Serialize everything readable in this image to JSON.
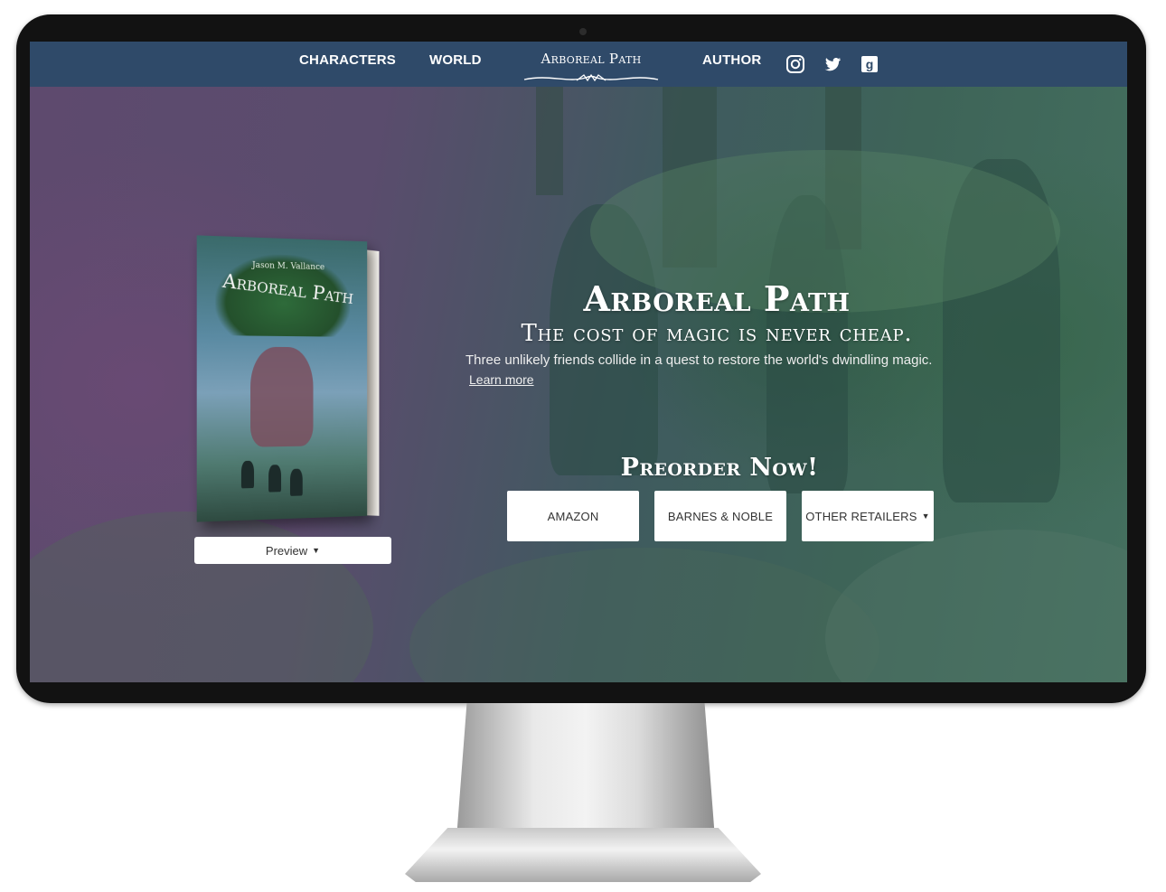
{
  "nav": {
    "links": [
      "CHARACTERS",
      "WORLD",
      "AUTHOR"
    ],
    "brand": "Arboreal Path",
    "social": [
      "instagram-icon",
      "twitter-icon",
      "goodreads-icon"
    ]
  },
  "book": {
    "author": "Jason M. Vallance",
    "title": "Arboreal Path"
  },
  "preview": {
    "label": "Preview"
  },
  "hero": {
    "title": "Arboreal Path",
    "tagline": "The cost of magic is never cheap.",
    "description": "Three unlikely friends collide in a quest to restore the world's dwindling magic.",
    "learn_more": "Learn more"
  },
  "preorder": {
    "title": "Preorder Now!",
    "retailers": [
      "AMAZON",
      "BARNES & NOBLE",
      "OTHER RETAILERS"
    ]
  },
  "colors": {
    "nav_bg": "#2f4a69",
    "button_bg": "#ffffff",
    "bezel": "#121212"
  }
}
